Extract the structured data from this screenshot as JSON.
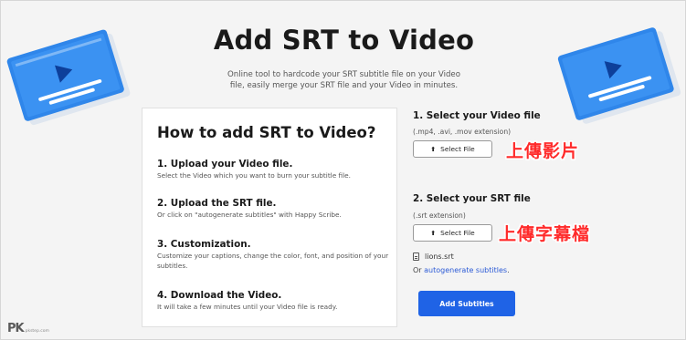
{
  "hero": {
    "title": "Add SRT to Video",
    "subtitle_line1": "Online tool to hardcode your SRT subtitle file on your Video",
    "subtitle_line2": "file, easily merge your SRT file and your Video in minutes."
  },
  "howto": {
    "title": "How to add SRT to Video?",
    "steps": [
      {
        "title": "1. Upload your Video file.",
        "desc": "Select the Video which you want to burn your subtitle file."
      },
      {
        "title": "2. Upload the SRT file.",
        "desc": "Or click on \"autogenerate subtitles\" with Happy Scribe."
      },
      {
        "title": "3. Customization.",
        "desc": "Customize your captions, change the color, font, and position of your subtitles."
      },
      {
        "title": "4. Download the Video.",
        "desc": "It will take a few minutes until your Video file is ready."
      }
    ]
  },
  "video_section": {
    "label": "1.  Select your Video file",
    "hint": "(.mp4, .avi, .mov extension)",
    "button_label": "Select File",
    "annotation": "上傳影片"
  },
  "srt_section": {
    "label": "2.  Select your SRT file",
    "hint": "(.srt extension)",
    "button_label": "Select File",
    "annotation": "上傳字幕檔",
    "selected_file": "lions.srt"
  },
  "autogen": {
    "prefix": "Or ",
    "link_text": "autogenerate subtitles",
    "suffix": "."
  },
  "submit_label": "Add Subtitles",
  "watermark": {
    "mark": "PK",
    "sub": "pkstep.com"
  },
  "colors": {
    "accent": "#1f63e6",
    "annotation": "#ff2b2b",
    "illustration_blue": "#2f86ea"
  }
}
